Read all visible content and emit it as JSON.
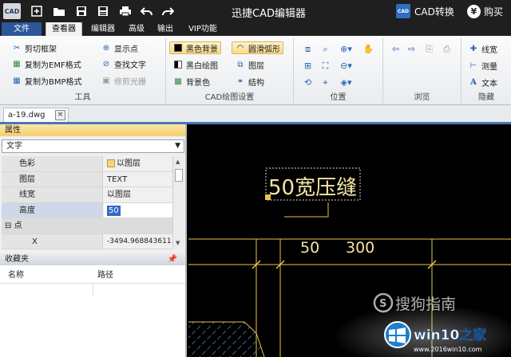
{
  "app": {
    "logo_text": "CAD",
    "title": "迅捷CAD编辑器",
    "cad_convert_label": "CAD转换",
    "buy_label": "购买",
    "buy_symbol": "¥"
  },
  "quick_access": [
    "new-icon",
    "open-folder-icon",
    "save-icon",
    "save-as-icon",
    "print-icon",
    "undo-icon",
    "redo-icon"
  ],
  "menu": {
    "file": "文件",
    "viewer": "查看器",
    "editor": "编辑器",
    "advanced": "高级",
    "output": "输出",
    "vip": "VIP功能",
    "active": "查看器"
  },
  "ribbon": {
    "tools": {
      "label": "工具",
      "clip_frame": "剪切框架",
      "copy_emf": "复制为EMF格式",
      "copy_bmp": "复制为BMP格式",
      "show_points": "显示点",
      "find_text": "查找文字",
      "trim_raster": "修剪光栅"
    },
    "drawing": {
      "label": "CAD绘图设置",
      "black_bg": "黑色背景",
      "smooth_arc": "圆滑弧形",
      "bw_drawing": "黑白绘图",
      "layers": "图层",
      "bg_color": "背景色",
      "structure": "结构"
    },
    "position": {
      "label": "位置"
    },
    "browse": {
      "label": "浏览"
    },
    "hide": {
      "label": "隐藏",
      "linewidth": "线宽",
      "measure": "测量",
      "text": "文本"
    }
  },
  "document": {
    "tab": "a-19.dwg",
    "close": "×"
  },
  "properties": {
    "title": "属性",
    "object_type": "文字",
    "rows": [
      {
        "name": "色彩",
        "value": "以图层"
      },
      {
        "name": "图层",
        "value": "TEXT"
      },
      {
        "name": "线宽",
        "value": "以图层"
      },
      {
        "name": "高度",
        "value": "50"
      },
      {
        "name": "点",
        "value": ""
      },
      {
        "name": "X",
        "value": "-3494.968843611"
      }
    ],
    "category_prefix": "⊟"
  },
  "favorites": {
    "title": "收藏夹",
    "col_name": "名称",
    "col_path": "路径"
  },
  "drawing": {
    "label_main": "50宽压缝",
    "dim_left": "50",
    "dim_right": "300"
  },
  "watermarks": {
    "sogou": "搜狗指南",
    "win10": "win10之家",
    "win10_url": "www.2016win10.com"
  },
  "colors": {
    "titlebar": "#1f1f1f",
    "file_tab": "#2b579a",
    "cad_line": "#e8c44a",
    "cad_text": "#f3e6a0",
    "selection": "#3169c6"
  }
}
